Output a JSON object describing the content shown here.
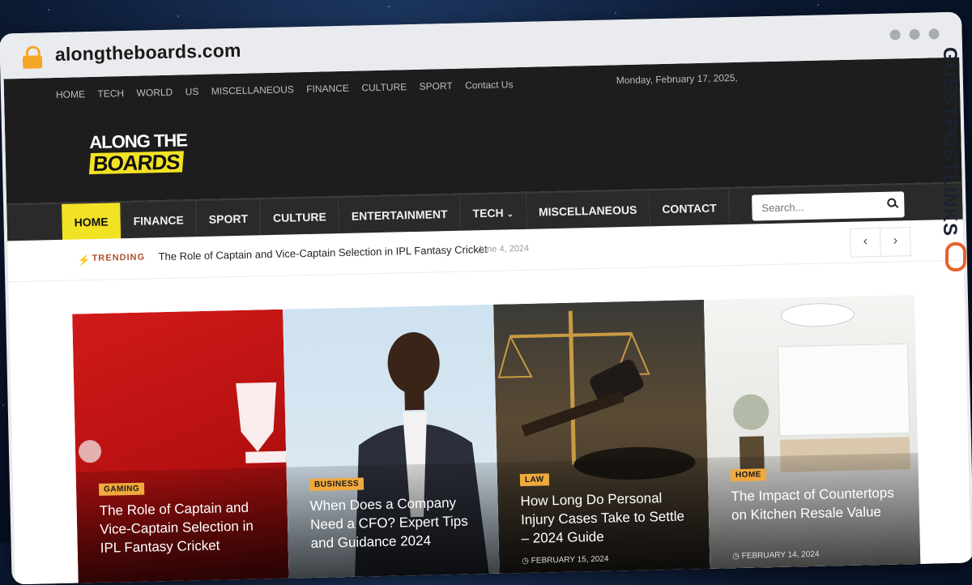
{
  "browser": {
    "url": "alongtheboards.com"
  },
  "header": {
    "top_nav": [
      "HOME",
      "TECH",
      "WORLD",
      "US",
      "MISCELLANEOUS",
      "FINANCE",
      "CULTURE",
      "SPORT",
      "Contact Us"
    ],
    "date": "Monday, February 17, 2025,",
    "logo": {
      "line1": "ALONG THE",
      "line2": "BOARDS"
    }
  },
  "main_nav": {
    "items": [
      "HOME",
      "FINANCE",
      "SPORT",
      "CULTURE",
      "ENTERTAINMENT",
      "TECH",
      "MISCELLANEOUS",
      "CONTACT"
    ],
    "active": "HOME",
    "search_placeholder": "Search..."
  },
  "trending": {
    "label": "TRENDING",
    "title": "The Role of Captain and Vice-Captain Selection in IPL Fantasy Cricket",
    "date": "June 4, 2024"
  },
  "cards": [
    {
      "category": "GAMING",
      "title": "The Role of Captain and Vice-Captain Selection in IPL Fantasy Cricket",
      "date": ""
    },
    {
      "category": "BUSINESS",
      "title": "When Does a Company Need a CFO? Expert Tips and Guidance 2024",
      "date": ""
    },
    {
      "category": "LAW",
      "title": "How Long Do Personal Injury Cases Take to Settle – 2024 Guide",
      "date": "FEBRUARY 15, 2024"
    },
    {
      "category": "HOME",
      "title": "The Impact of Countertops on Kitchen Resale Value",
      "date": "FEBRUARY 14, 2024"
    }
  ],
  "watermark": {
    "text": "GUESTPOSTLINKS"
  },
  "colors": {
    "accent": "#f2e224",
    "badge": "#f0a93d",
    "header_bg": "#1d1d1d",
    "nav_bg": "#2a2a2a",
    "trending": "#b0522b"
  }
}
